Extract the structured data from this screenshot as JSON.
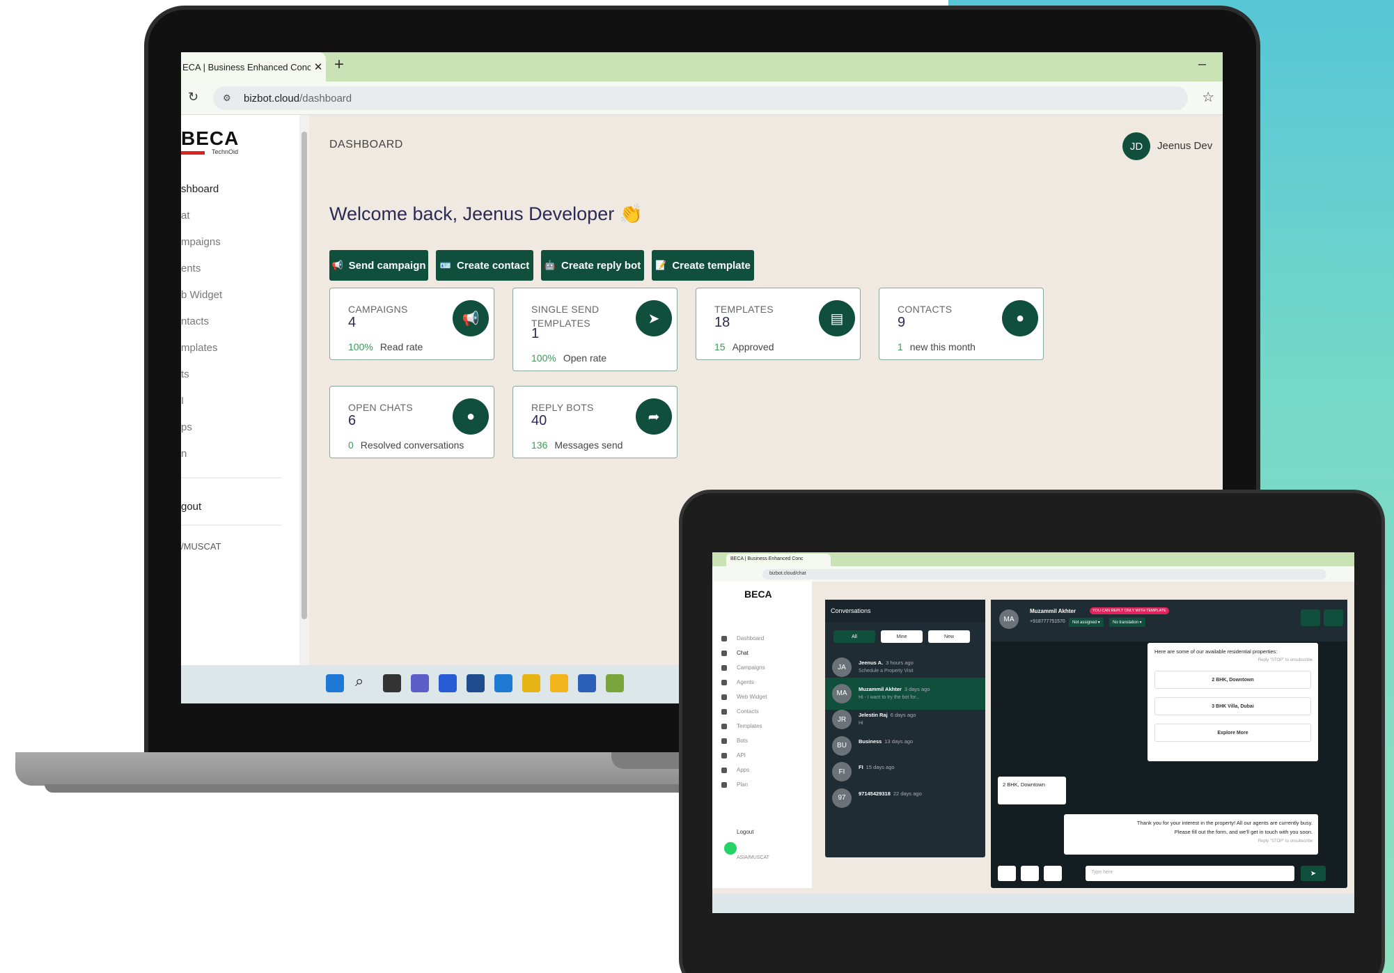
{
  "laptop": {
    "browser": {
      "tab_title": "ECA | Business Enhanced Conc",
      "tab_close": "✕",
      "new_tab": "+",
      "minimize": "–",
      "url_host": "bizbot.cloud",
      "url_path": "/dashboard"
    },
    "sidebar": {
      "logo": "BECA",
      "logo_sub": "TechnOid",
      "items": [
        {
          "label": "shboard",
          "active": true
        },
        {
          "label": "at"
        },
        {
          "label": "mpaigns"
        },
        {
          "label": "ents"
        },
        {
          "label": "b Widget"
        },
        {
          "label": "ntacts"
        },
        {
          "label": "mplates"
        },
        {
          "label": "ts"
        },
        {
          "label": "I"
        },
        {
          "label": "ps"
        },
        {
          "label": "n"
        }
      ],
      "logout": "gout",
      "footer": "/MUSCAT"
    },
    "header": {
      "title": "DASHBOARD",
      "avatar_initials": "JD",
      "user_name": "Jeenus Dev"
    },
    "welcome": "Welcome back, Jeenus Developer",
    "welcome_emoji": "👏",
    "actions": [
      {
        "label": "Send campaign",
        "icon": "megaphone-icon",
        "glyph": "📢"
      },
      {
        "label": "Create contact",
        "icon": "contact-card-icon",
        "glyph": "🪪"
      },
      {
        "label": "Create reply bot",
        "icon": "bot-icon",
        "glyph": "🤖"
      },
      {
        "label": "Create template",
        "icon": "template-icon",
        "glyph": "📝"
      }
    ],
    "cards": [
      {
        "label": "CAMPAIGNS",
        "value": "4",
        "metric": "100%",
        "metric_label": "Read rate",
        "icon": "megaphone-icon"
      },
      {
        "label": "SINGLE SEND TEMPLATES",
        "value": "1",
        "metric": "100%",
        "metric_label": "Open rate",
        "icon": "send-icon"
      },
      {
        "label": "TEMPLATES",
        "value": "18",
        "metric": "15",
        "metric_label": "Approved",
        "icon": "document-icon"
      },
      {
        "label": "CONTACTS",
        "value": "9",
        "metric": "1",
        "metric_label": "new this month",
        "icon": "user-icon"
      },
      {
        "label": "OPEN CHATS",
        "value": "6",
        "metric": "0",
        "metric_label": "Resolved conversations",
        "icon": "chat-bubble-icon"
      },
      {
        "label": "REPLY BOTS",
        "value": "40",
        "metric": "136",
        "metric_label": "Messages send",
        "icon": "share-arrow-icon"
      }
    ]
  },
  "tablet": {
    "browser": {
      "tab_title": "BECA | Business Enhanced Conc",
      "url": "bizbot.cloud/chat"
    },
    "sidebar": {
      "logo": "BECA",
      "items": [
        "Dashboard",
        "Chat",
        "Campaigns",
        "Agents",
        "Web Widget",
        "Contacts",
        "Templates",
        "Bots",
        "API",
        "Apps",
        "Plan"
      ],
      "active": "Chat",
      "logout": "Logout",
      "footer": "ASIA/MUSCAT"
    },
    "conversations": {
      "title": "Conversations",
      "filters": [
        "All",
        "Mine",
        "New"
      ],
      "items": [
        {
          "initials": "JA",
          "name": "Jeenus A.",
          "ago": "3 hours ago",
          "preview": "Schedule a Property Visit"
        },
        {
          "initials": "MA",
          "name": "Muzammil Akhter",
          "ago": "3 days ago",
          "preview": "Hi - I want to try the bot for..."
        },
        {
          "initials": "JR",
          "name": "Jelestin Raj",
          "ago": "6 days ago",
          "preview": "Hi"
        },
        {
          "initials": "BU",
          "name": "Business",
          "ago": "13 days ago",
          "preview": ""
        },
        {
          "initials": "FI",
          "name": "FI",
          "ago": "15 days ago",
          "preview": ""
        },
        {
          "initials": "97",
          "name": "97145429318",
          "ago": "22 days ago",
          "preview": ""
        }
      ]
    },
    "chat": {
      "avatar": "MA",
      "name": "Muzammil Akhter",
      "badge": "YOU CAN REPLY ONLY WITH TEMPLATE",
      "phone": "+918777751570",
      "assign": "Not assigned ▾",
      "translate": "No translation ▾",
      "msg1": "Here are some of our available residential properties:",
      "msg1_meta": "Reply \"STOP\" to unsubscribe",
      "options": [
        "2 BHK, Downtown",
        "3 BHK Villa, Dubai",
        "Explore More"
      ],
      "reply": "2 BHK, Downtown",
      "msg2_line1": "Thank you for your interest in the property! All our agents are currently busy.",
      "msg2_line2": "Please fill out the form, and we'll get in touch with you soon.",
      "msg2_meta": "Reply \"STOP\" to unsubscribe",
      "input_placeholder": "Type here",
      "send": "➤"
    }
  },
  "colors": {
    "brand_green": "#0f4f3c",
    "accent_teal": "#6dd3c7",
    "positive": "#3a9a55"
  }
}
